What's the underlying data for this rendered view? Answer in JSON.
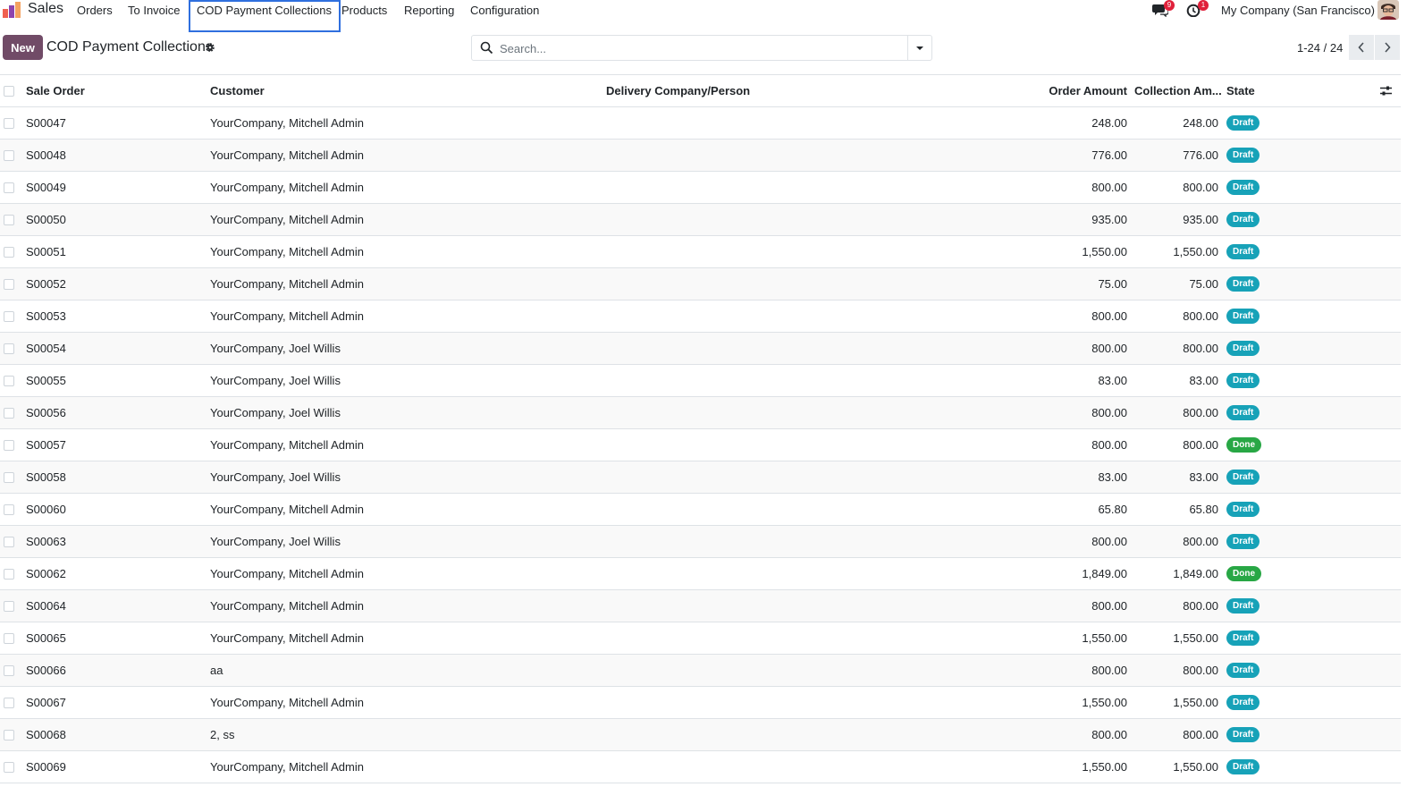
{
  "nav": {
    "app_name": "Sales",
    "menu": [
      {
        "label": "Orders"
      },
      {
        "label": "To Invoice"
      },
      {
        "label": "COD Payment Collections"
      },
      {
        "label": "Products"
      },
      {
        "label": "Reporting"
      },
      {
        "label": "Configuration"
      }
    ],
    "messages_badge": "9",
    "activities_badge": "1",
    "company": "My Company (San Francisco)",
    "icons": [
      "app-logo-icon",
      "chat-icon",
      "clock-icon",
      "avatar"
    ]
  },
  "control": {
    "new_label": "New",
    "title": "COD Payment Collections",
    "search_placeholder": "Search...",
    "pager": "1-24 / 24"
  },
  "table": {
    "headers": {
      "sale_order": "Sale Order",
      "customer": "Customer",
      "delivery": "Delivery Company/Person",
      "order_amount": "Order Amount",
      "collection_amount": "Collection Am...",
      "state": "State"
    },
    "rows": [
      {
        "order": "S00047",
        "customer": "YourCompany, Mitchell Admin",
        "delivery": "",
        "amount": "248.00",
        "collection": "248.00",
        "state": "Draft"
      },
      {
        "order": "S00048",
        "customer": "YourCompany, Mitchell Admin",
        "delivery": "",
        "amount": "776.00",
        "collection": "776.00",
        "state": "Draft"
      },
      {
        "order": "S00049",
        "customer": "YourCompany, Mitchell Admin",
        "delivery": "",
        "amount": "800.00",
        "collection": "800.00",
        "state": "Draft"
      },
      {
        "order": "S00050",
        "customer": "YourCompany, Mitchell Admin",
        "delivery": "",
        "amount": "935.00",
        "collection": "935.00",
        "state": "Draft"
      },
      {
        "order": "S00051",
        "customer": "YourCompany, Mitchell Admin",
        "delivery": "",
        "amount": "1,550.00",
        "collection": "1,550.00",
        "state": "Draft"
      },
      {
        "order": "S00052",
        "customer": "YourCompany, Mitchell Admin",
        "delivery": "",
        "amount": "75.00",
        "collection": "75.00",
        "state": "Draft"
      },
      {
        "order": "S00053",
        "customer": "YourCompany, Mitchell Admin",
        "delivery": "",
        "amount": "800.00",
        "collection": "800.00",
        "state": "Draft"
      },
      {
        "order": "S00054",
        "customer": "YourCompany, Joel Willis",
        "delivery": "",
        "amount": "800.00",
        "collection": "800.00",
        "state": "Draft"
      },
      {
        "order": "S00055",
        "customer": "YourCompany, Joel Willis",
        "delivery": "",
        "amount": "83.00",
        "collection": "83.00",
        "state": "Draft"
      },
      {
        "order": "S00056",
        "customer": "YourCompany, Joel Willis",
        "delivery": "",
        "amount": "800.00",
        "collection": "800.00",
        "state": "Draft"
      },
      {
        "order": "S00057",
        "customer": "YourCompany, Mitchell Admin",
        "delivery": "",
        "amount": "800.00",
        "collection": "800.00",
        "state": "Done"
      },
      {
        "order": "S00058",
        "customer": "YourCompany, Joel Willis",
        "delivery": "",
        "amount": "83.00",
        "collection": "83.00",
        "state": "Draft"
      },
      {
        "order": "S00060",
        "customer": "YourCompany, Mitchell Admin",
        "delivery": "",
        "amount": "65.80",
        "collection": "65.80",
        "state": "Draft"
      },
      {
        "order": "S00063",
        "customer": "YourCompany, Joel Willis",
        "delivery": "",
        "amount": "800.00",
        "collection": "800.00",
        "state": "Draft"
      },
      {
        "order": "S00062",
        "customer": "YourCompany, Mitchell Admin",
        "delivery": "",
        "amount": "1,849.00",
        "collection": "1,849.00",
        "state": "Done"
      },
      {
        "order": "S00064",
        "customer": "YourCompany, Mitchell Admin",
        "delivery": "",
        "amount": "800.00",
        "collection": "800.00",
        "state": "Draft"
      },
      {
        "order": "S00065",
        "customer": "YourCompany, Mitchell Admin",
        "delivery": "",
        "amount": "1,550.00",
        "collection": "1,550.00",
        "state": "Draft"
      },
      {
        "order": "S00066",
        "customer": "aa",
        "delivery": "",
        "amount": "800.00",
        "collection": "800.00",
        "state": "Draft"
      },
      {
        "order": "S00067",
        "customer": "YourCompany, Mitchell Admin",
        "delivery": "",
        "amount": "1,550.00",
        "collection": "1,550.00",
        "state": "Draft"
      },
      {
        "order": "S00068",
        "customer": "2, ss",
        "delivery": "",
        "amount": "800.00",
        "collection": "800.00",
        "state": "Draft"
      },
      {
        "order": "S00069",
        "customer": "YourCompany, Mitchell Admin",
        "delivery": "",
        "amount": "1,550.00",
        "collection": "1,550.00",
        "state": "Draft"
      }
    ]
  },
  "colors": {
    "brand": "#714b67",
    "draft_badge": "#17a2b8",
    "done_badge": "#28a745",
    "focus_outline": "#2f6fde",
    "notification_badge": "#e0213b"
  }
}
